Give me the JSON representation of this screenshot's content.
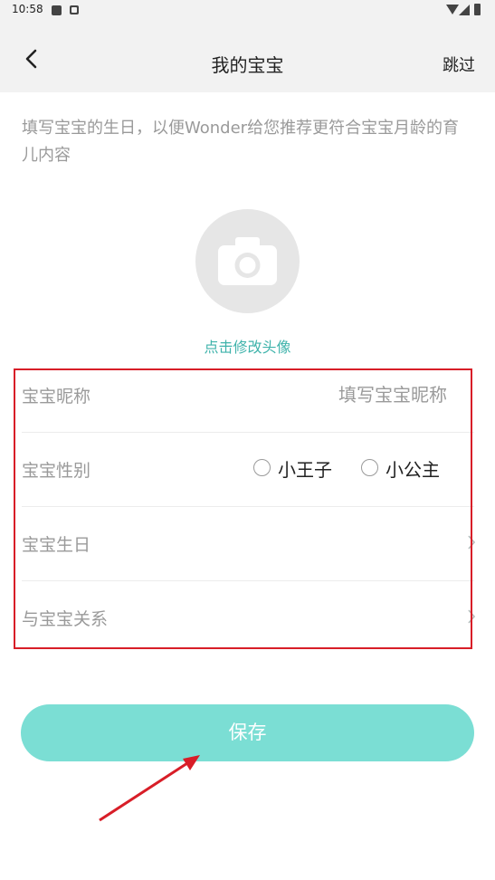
{
  "status_bar": {
    "time": "10:58",
    "icons": [
      "gallery-icon",
      "notification-a-icon",
      "wifi-icon",
      "signal-icon",
      "battery-icon"
    ]
  },
  "header": {
    "title": "我的宝宝",
    "skip_label": "跳过",
    "back_icon": "chevron-left-icon"
  },
  "intro": {
    "text": "填写宝宝的生日，以便Wonder给您推荐更符合宝宝月龄的育儿内容"
  },
  "avatar": {
    "icon": "camera-icon",
    "change_label": "点击修改头像"
  },
  "form": {
    "nickname": {
      "label": "宝宝昵称",
      "placeholder": "填写宝宝昵称",
      "value": ""
    },
    "gender": {
      "label": "宝宝性别",
      "options": [
        "小王子",
        "小公主"
      ],
      "selected": null
    },
    "birthday": {
      "label": "宝宝生日",
      "value": ""
    },
    "relation": {
      "label": "与宝宝关系",
      "value": ""
    }
  },
  "save_label": "保存",
  "colors": {
    "accent": "#3fb3ab",
    "save_button": "#7bded4",
    "annotation": "#d81e28",
    "header_bg": "#f2f2f2",
    "muted_text": "#9a9a9a"
  }
}
